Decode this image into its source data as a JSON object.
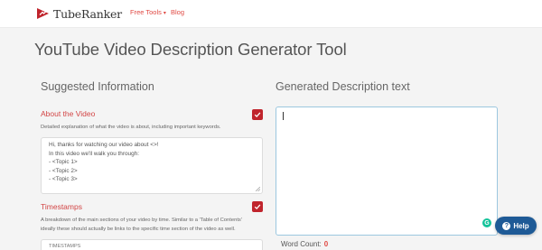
{
  "header": {
    "brand": "TubeRanker",
    "nav": [
      {
        "label": "Free Tools",
        "caret": "▾"
      },
      {
        "label": "Blog"
      }
    ]
  },
  "page": {
    "title": "YouTube Video Description Generator Tool"
  },
  "left": {
    "heading": "Suggested Information",
    "about": {
      "label": "About the Video",
      "description": "Detailed explanation of what the video is about, including important keywords.",
      "checked": true,
      "value_lines": [
        "Hi, thanks for watching our video about <>!",
        "In this video we'll walk you through:",
        "- <Topic 1>",
        "- <Topic 2>",
        "- <Topic 3>"
      ]
    },
    "timestamps": {
      "label": "Timestamps",
      "description_lines": [
        "A breakdown of the main sections of your video by time. Similar to a 'Table of Contents'",
        "ideally these should actually be links to the specific time section of the video as well."
      ],
      "checked": true,
      "value_first_line": "TIMESTAMPS"
    }
  },
  "right": {
    "heading": "Generated Description text",
    "output_value": "",
    "word_count_label": "Word Count:",
    "word_count": "0"
  },
  "widgets": {
    "help_label": "Help",
    "grammarly_glyph": "G"
  },
  "colors": {
    "accent": "#e04a44",
    "checkbox": "#c0242c",
    "help": "#1e5a96",
    "grammarly": "#15c39a"
  }
}
